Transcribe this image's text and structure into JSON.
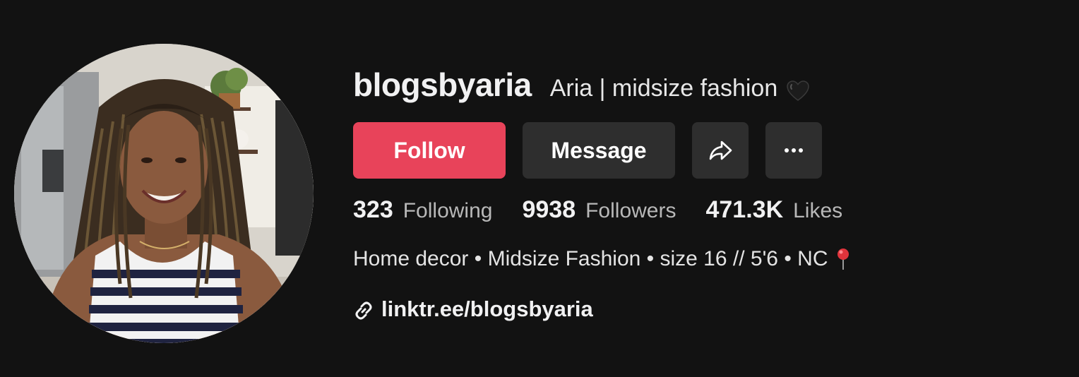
{
  "profile": {
    "username": "blogsbyaria",
    "nickname": "Aria | midsize fashion",
    "nickname_emoji": "black-heart-icon"
  },
  "actions": {
    "follow_label": "Follow",
    "message_label": "Message",
    "share_icon": "share-icon",
    "more_icon": "more-icon"
  },
  "stats": {
    "following_count": "323",
    "following_label": "Following",
    "followers_count": "9938",
    "followers_label": "Followers",
    "likes_count": "471.3K",
    "likes_label": "Likes"
  },
  "bio": {
    "text": "Home decor • Midsize Fashion • size 16 // 5'6 • NC",
    "emoji": "round-pushpin-icon"
  },
  "link": {
    "text": "linktr.ee/blogsbyaria",
    "icon": "link-icon"
  },
  "colors": {
    "background": "#121212",
    "follow_button": "#e8435a",
    "secondary_button": "#2e2e2e",
    "muted_text": "#b8b8b8"
  }
}
